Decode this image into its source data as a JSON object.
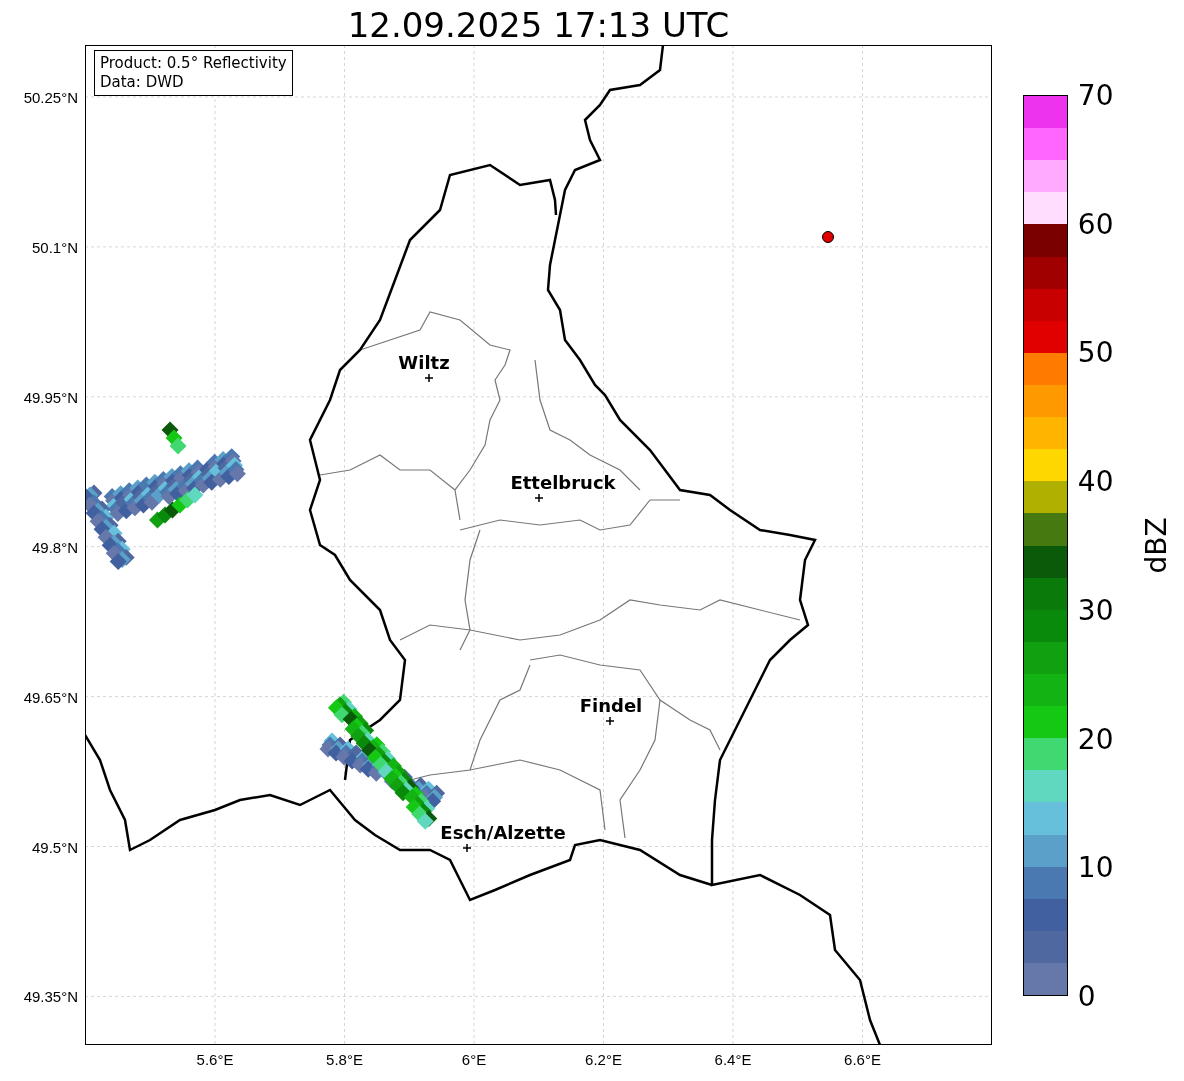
{
  "title": "12.09.2025 17:13 UTC",
  "info_box": [
    "Product: 0.5° Reflectivity",
    "Data: DWD"
  ],
  "map": {
    "x_ticks": [
      "5.6°E",
      "5.8°E",
      "6°E",
      "6.2°E",
      "6.4°E",
      "6.6°E"
    ],
    "y_ticks": [
      "50.25°N",
      "50.1°N",
      "49.95°N",
      "49.8°N",
      "49.65°N",
      "49.5°N",
      "49.35°N"
    ],
    "cities": [
      {
        "name": "Wiltz"
      },
      {
        "name": "Ettelbruck"
      },
      {
        "name": "Findel"
      },
      {
        "name": "Esch/Alzette"
      }
    ]
  },
  "colorbar": {
    "label": "dBZ",
    "ticks": [
      "70",
      "60",
      "50",
      "40",
      "30",
      "20",
      "10",
      "0"
    ],
    "segments": [
      {
        "color": "#ee33ee"
      },
      {
        "color": "#ff66ff"
      },
      {
        "color": "#ffaaff"
      },
      {
        "color": "#ffddff"
      },
      {
        "color": "#7a0000"
      },
      {
        "color": "#a00000"
      },
      {
        "color": "#c80000"
      },
      {
        "color": "#e00000"
      },
      {
        "color": "#ff7b00"
      },
      {
        "color": "#ff9900"
      },
      {
        "color": "#ffb400"
      },
      {
        "color": "#ffd700"
      },
      {
        "color": "#b0b000"
      },
      {
        "color": "#467a10"
      },
      {
        "color": "#0a5a0a"
      },
      {
        "color": "#0a7a0a"
      },
      {
        "color": "#0a8a0a"
      },
      {
        "color": "#10a010"
      },
      {
        "color": "#12b312"
      },
      {
        "color": "#14c814"
      },
      {
        "color": "#40d870"
      },
      {
        "color": "#60d8c0"
      },
      {
        "color": "#66c0dc"
      },
      {
        "color": "#5aa0c8"
      },
      {
        "color": "#4a78b0"
      },
      {
        "color": "#4060a0"
      },
      {
        "color": "#5068a0"
      },
      {
        "color": "#6677aa"
      }
    ]
  }
}
